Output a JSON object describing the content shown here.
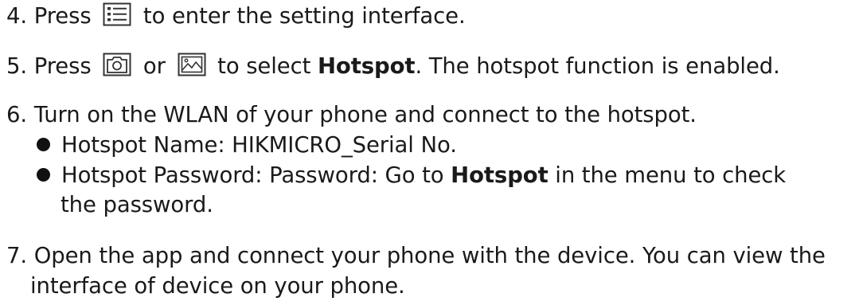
{
  "steps": [
    {
      "number": "4.",
      "pre": "Press",
      "icon": "menu-icon",
      "post": "to enter the setting interface."
    },
    {
      "number": "5.",
      "pre": "Press",
      "icon1": "camera-icon",
      "mid": "or",
      "icon2": "gallery-icon",
      "post_a": "to select",
      "bold": "Hotspot",
      "post_b": ". The hotspot function is enabled."
    },
    {
      "number": "6.",
      "text": "Turn on the WLAN of your phone and connect to the hotspot.",
      "bullets": [
        {
          "text": "Hotspot Name: HIKMICRO_Serial No."
        },
        {
          "pre": "Hotspot Password: Password: Go to",
          "bold": "Hotspot",
          "post": "in the menu to check",
          "cont": "the password."
        }
      ]
    },
    {
      "number": "7.",
      "line1": "Open the app and connect your phone with the device. You can view the",
      "line2": "interface of device on your phone."
    }
  ]
}
